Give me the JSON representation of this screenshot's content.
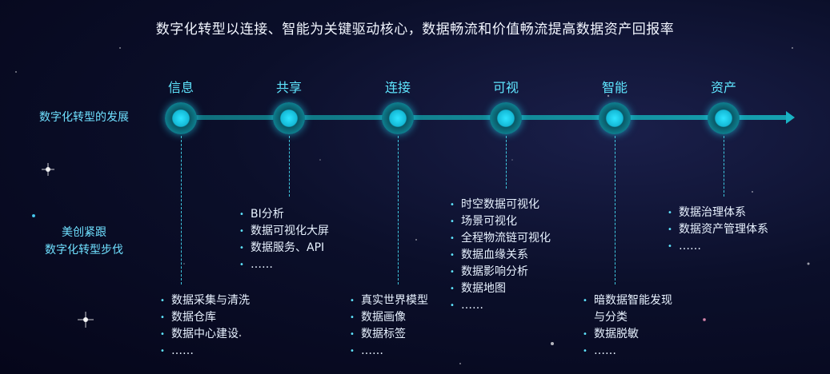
{
  "title": "数字化转型以连接、智能为关键驱动核心，数据畅流和价值畅流提高数据资产回报率",
  "side_labels": {
    "development": "数字化转型的发展",
    "follow_line1": "美创紧跟",
    "follow_line2": "数字化转型步伐"
  },
  "stages": [
    {
      "label": "信息",
      "items": [
        "数据采集与清洗",
        "数据仓库",
        "数据中心建设",
        "……"
      ]
    },
    {
      "label": "共享",
      "items": [
        "BI分析",
        "数据可视化大屏",
        "数据服务、API",
        "……"
      ]
    },
    {
      "label": "连接",
      "items": [
        "真实世界模型",
        "数据画像",
        "数据标签",
        "……"
      ]
    },
    {
      "label": "可视",
      "items": [
        "时空数据可视化",
        "场景可视化",
        "全程物流链可视化",
        "数据血缘关系",
        "数据影响分析",
        "数据地图",
        "……"
      ]
    },
    {
      "label": "智能",
      "items": [
        "暗数据智能发现",
        "与分类",
        "数据脱敏",
        "……"
      ]
    },
    {
      "label": "资产",
      "items": [
        "数据治理体系",
        "数据资产管理体系",
        "……"
      ]
    }
  ],
  "colors": {
    "accent": "#5fe6ff",
    "track": "#15a1b0",
    "background": "#0b0f2a"
  }
}
